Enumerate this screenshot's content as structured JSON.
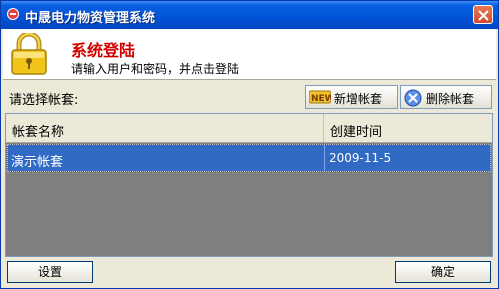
{
  "window": {
    "title": "中晟电力物资管理系统"
  },
  "header": {
    "title": "系统登陆",
    "subtitle": "请输入用户和密码，并点击登陆"
  },
  "toolbar": {
    "prompt": "请选择帐套:",
    "add_label": "新增帐套",
    "delete_label": "删除帐套"
  },
  "grid": {
    "columns": [
      "帐套名称",
      "创建时间"
    ],
    "rows": [
      {
        "name": "演示帐套",
        "created": "2009-11-5"
      }
    ]
  },
  "footer": {
    "settings_label": "设置",
    "ok_label": "确定"
  }
}
